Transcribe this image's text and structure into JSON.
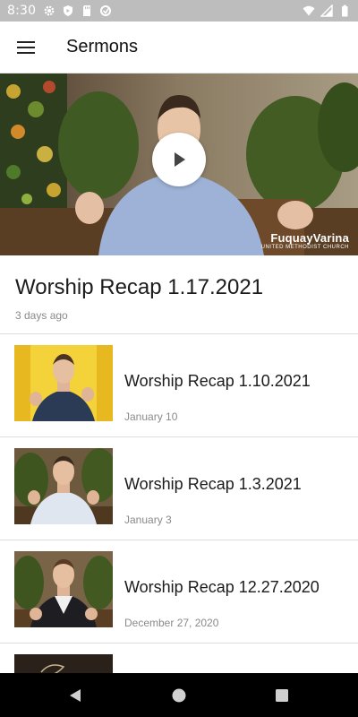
{
  "status_bar": {
    "time": "8:30",
    "left_icons": [
      "gear-icon",
      "shield-icon",
      "sd-card-icon",
      "sync-icon"
    ],
    "right_icons": [
      "wifi-icon",
      "signal-icon",
      "battery-icon"
    ]
  },
  "app_bar": {
    "title": "Sermons",
    "menu_icon": "hamburger-menu-icon"
  },
  "hero": {
    "play_icon": "play-icon",
    "watermark_main": "FuquayVarina",
    "watermark_sub": "UNITED METHODIST CHURCH"
  },
  "featured": {
    "title": "Worship Recap 1.17.2021",
    "date": "3 days ago"
  },
  "sermons": [
    {
      "title": "Worship Recap 1.10.2021",
      "date": "January 10"
    },
    {
      "title": "Worship Recap 1.3.2021",
      "date": "January 3"
    },
    {
      "title": "Worship Recap 12.27.2020",
      "date": "December 27, 2020"
    }
  ],
  "nav_bar": {
    "buttons": [
      "back-icon",
      "home-icon",
      "recents-icon"
    ]
  },
  "colors": {
    "status_bar": "#bdbdbd",
    "nav_bar": "#000000",
    "divider": "#dcdcdc",
    "secondary_text": "#8a8a8a"
  }
}
